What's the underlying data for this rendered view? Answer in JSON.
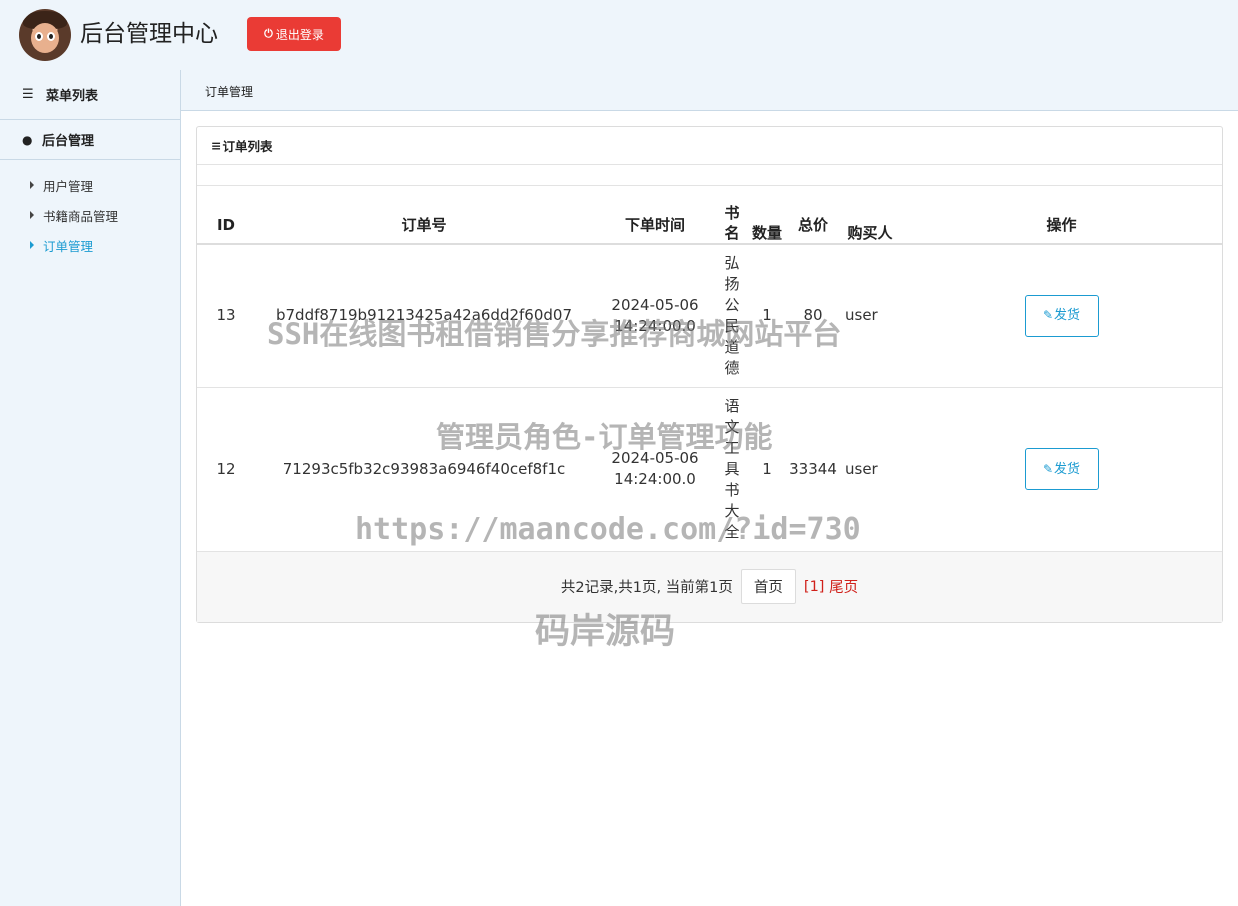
{
  "header": {
    "title": "后台管理中心",
    "logout_label": "退出登录"
  },
  "sidebar": {
    "menu_title": "菜单列表",
    "group_title": "后台管理",
    "items": [
      {
        "label": "用户管理",
        "active": false
      },
      {
        "label": "书籍商品管理",
        "active": false
      },
      {
        "label": "订单管理",
        "active": true
      }
    ]
  },
  "breadcrumb": "订单管理",
  "panel": {
    "title": "订单列表"
  },
  "table": {
    "columns": [
      "ID",
      "订单号",
      "下单时间",
      "书名",
      "数量",
      "总价",
      "购买人",
      "操作"
    ],
    "rows": [
      {
        "id": "13",
        "order_no": "b7ddf8719b91213425a42a6dd2f60d07",
        "time": "2024-05-06 14:24:00.0",
        "book": "弘扬公民道德",
        "qty": "1",
        "total": "80",
        "buyer": "user",
        "action": "发货"
      },
      {
        "id": "12",
        "order_no": "71293c5fb32c93983a6946f40cef8f1c",
        "time": "2024-05-06 14:24:00.0",
        "book": "语文工具书大全",
        "qty": "1",
        "total": "33344",
        "buyer": "user",
        "action": "发货"
      }
    ]
  },
  "pager": {
    "summary": "共2记录,共1页, 当前第1页",
    "first": "首页",
    "current": "[1]",
    "last": "尾页"
  },
  "watermark": {
    "line1": "SSH在线图书租借销售分享推荐商城网站平台",
    "line2": "管理员角色-订单管理功能",
    "line3": "https://maancode.com/?id=730",
    "line4": "码岸源码"
  },
  "colors": {
    "accent": "#1b9bd1",
    "danger": "#ea3b35",
    "header_bg": "#eef5fb"
  }
}
